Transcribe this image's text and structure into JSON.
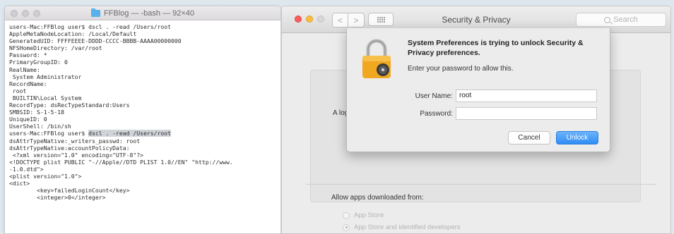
{
  "terminal": {
    "title": "FFBlog — -bash — 92×40",
    "lines": [
      "users-Mac:FFBlog user$ dscl . -read /Users/root",
      "AppleMetaNodeLocation: /Local/Default",
      "GeneratedUID: FFFFEEEE-DDDD-CCCC-BBBB-AAAA00000000",
      "NFSHomeDirectory: /var/root",
      "Password: *",
      "PrimaryGroupID: 0",
      "RealName:",
      " System Administrator",
      "RecordName:",
      " root",
      " BUILTIN\\Local System",
      "RecordType: dsRecTypeStandard:Users",
      "SMBSID: S-1-5-18",
      "UniqueID: 0",
      "UserShell: /bin/sh",
      "users-Mac:FFBlog user$ dscl . -read /Users/root",
      "dsAttrTypeNative:_writers_passwd: root",
      "dsAttrTypeNative:accountPolicyData:",
      " <?xml version=\"1.0\" encoding=\"UTF-8\"?>",
      "<!DOCTYPE plist PUBLIC \"-//Apple//DTD PLIST 1.0//EN\" \"http://www.",
      "-1.0.dtd\">",
      "<plist version=\"1.0\">",
      "<dict>",
      "        <key>failedLoginCount</key>",
      "        <integer>0</integer>"
    ],
    "highlighted_command": "dscl . -read /Users/root",
    "prompt": "users-Mac:FFBlog user$ "
  },
  "prefs": {
    "title": "Security & Privacy",
    "search_placeholder": "Search",
    "nav_back": "<",
    "nav_forward": ">",
    "a_log_text": "A log",
    "allow_label": "Allow apps downloaded from:",
    "radio_options": [
      {
        "label": "App Store",
        "selected": false
      },
      {
        "label": "App Store and identified developers",
        "selected": true
      }
    ]
  },
  "dialog": {
    "heading": "System Preferences is trying to unlock Security & Privacy preferences.",
    "subtext": "Enter your password to allow this.",
    "username_label": "User Name:",
    "username_value": "root",
    "password_label": "Password:",
    "password_value": "",
    "cancel_label": "Cancel",
    "unlock_label": "Unlock"
  },
  "colors": {
    "accent": "#2f8df4",
    "close": "#fc605c",
    "minimize": "#fdbc40",
    "lock_gold": "#f0a820"
  }
}
